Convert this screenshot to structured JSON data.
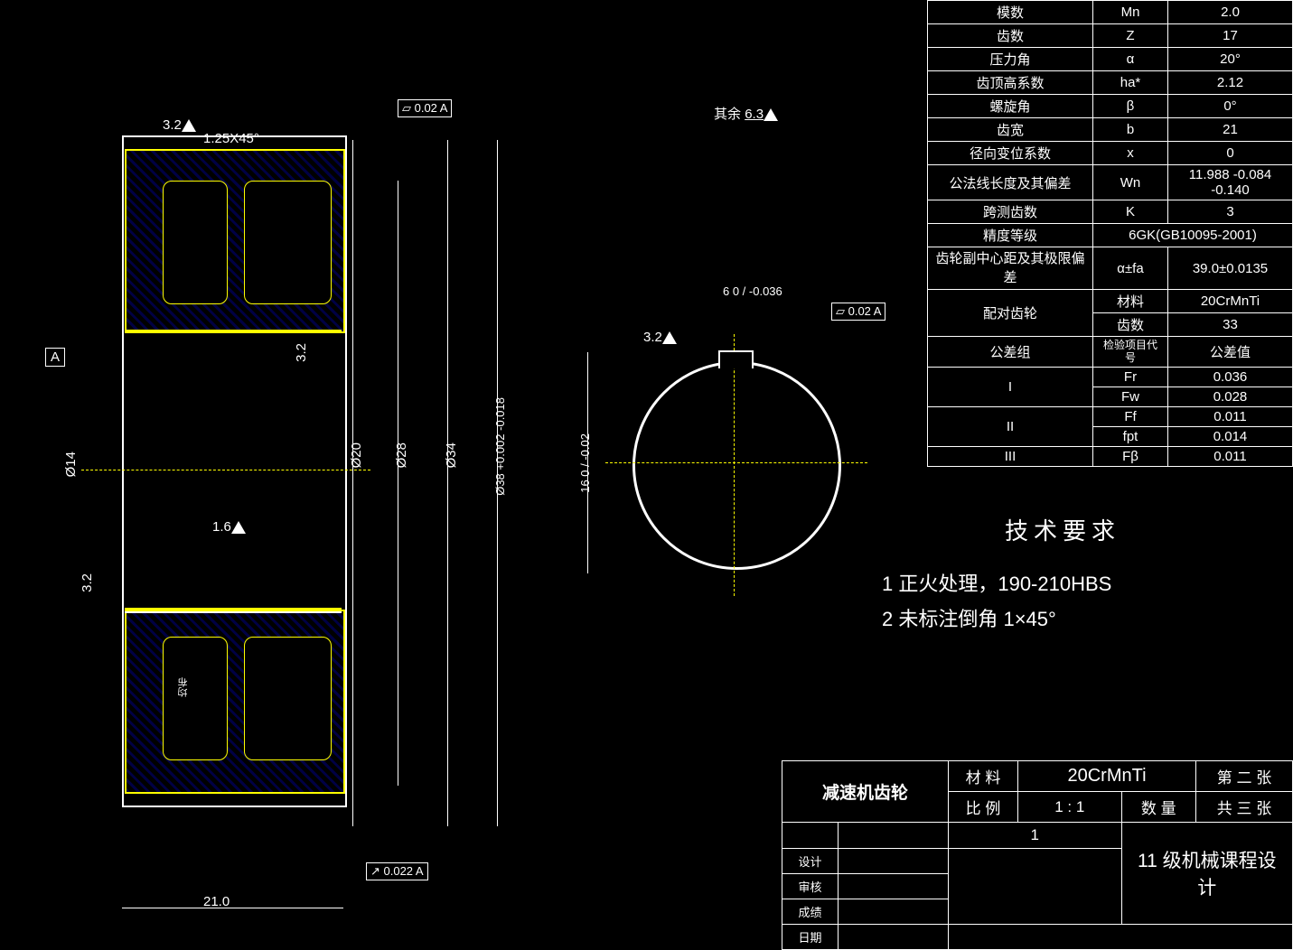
{
  "param_rows": [
    {
      "l": "模数",
      "s": "Mn",
      "v": "2.0"
    },
    {
      "l": "齿数",
      "s": "Z",
      "v": "17"
    },
    {
      "l": "压力角",
      "s": "α",
      "v": "20°"
    },
    {
      "l": "齿顶高系数",
      "s": "ha*",
      "v": "2.12"
    },
    {
      "l": "螺旋角",
      "s": "β",
      "v": "0°"
    },
    {
      "l": "齿宽",
      "s": "b",
      "v": "21"
    },
    {
      "l": "径向变位系数",
      "s": "x",
      "v": "0"
    },
    {
      "l": "公法线长度及其偏差",
      "s": "Wn",
      "v": "11.988 -0.084 -0.140"
    },
    {
      "l": "跨测齿数",
      "s": "K",
      "v": "3"
    }
  ],
  "precision": {
    "l": "精度等级",
    "v": "6GK(GB10095-2001)"
  },
  "center": {
    "l": "齿轮副中心距及其极限偏差",
    "s": "α±fa",
    "v": "39.0±0.0135"
  },
  "mate": {
    "l": "配对齿轮",
    "mat_l": "材料",
    "mat_v": "20CrMnTi",
    "z_l": "齿数",
    "z_v": "33"
  },
  "tolgroup": {
    "l": "公差组",
    "c2": "检验项目代号",
    "c3": "公差值"
  },
  "g1": {
    "l": "I",
    "r": [
      [
        "Fr",
        "0.036"
      ],
      [
        "Fw",
        "0.028"
      ]
    ]
  },
  "g2": {
    "l": "II",
    "r": [
      [
        "Ff",
        "0.011"
      ],
      [
        "fpt",
        "0.014"
      ]
    ]
  },
  "g3": {
    "l": "III",
    "r": [
      [
        "Fβ",
        "0.011"
      ]
    ]
  },
  "tech": {
    "title": "技术要求",
    "l1": "1 正火处理，190-210HBS",
    "l2": "2 未标注倒角  1×45°"
  },
  "tb": {
    "name": "减速机齿轮",
    "mat_l": "材 料",
    "mat_v": "20CrMnTi",
    "scale_l": "比 例",
    "scale_v": "1 : 1",
    "qty_l": "数 量",
    "qty_v": "1",
    "page_l": "第 二 张",
    "pages_l": "共 三 张",
    "design": "设计",
    "check": "审核",
    "score": "成绩",
    "date": "日期",
    "proj": "11 级机械课程设计"
  },
  "dims": {
    "chamfer": "1.25X45°",
    "d14": "Ø14",
    "d20": "Ø20",
    "d28": "Ø28",
    "d34": "Ø34",
    "d38": "Ø38 +0.002 -0.018",
    "width": "21.0",
    "sf32": "3.2",
    "sf16": "1.6",
    "sf63": "6.3",
    "qiyu": "其余",
    "key_w": "6  0 / -0.036",
    "key_h": "16  0 / -0.02",
    "fcf1": "⏥ 0.02 A",
    "fcf2": "↗ 0.022 A",
    "fcf3": "⏥ 0.02 A",
    "datumA": "A",
    "junbu": "均布"
  }
}
